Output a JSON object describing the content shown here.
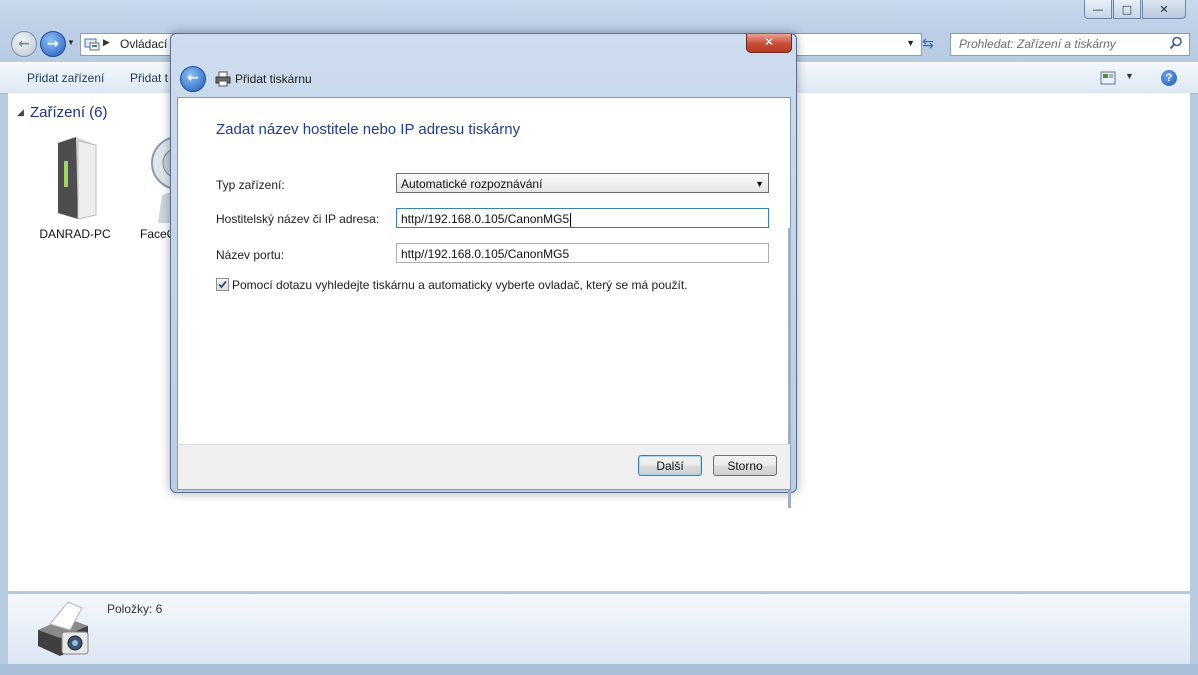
{
  "window": {
    "caption_buttons": {
      "minimize": "—",
      "maximize": "□",
      "close": "✕"
    }
  },
  "address_bar": {
    "path_text": "Ovládací",
    "search_placeholder": "Prohledat: Zařízení a tiskárny"
  },
  "toolbar": {
    "items": [
      "Přidat zařízení",
      "Přidat t"
    ]
  },
  "devices": {
    "group_header": "Zařízení (6)",
    "items": [
      "DANRAD-PC",
      "FaceC"
    ]
  },
  "details": {
    "item_count": "Položky: 6"
  },
  "dialog": {
    "title": "Přidat tiskárnu",
    "heading": "Zadat název hostitele nebo IP adresu tiskárny",
    "device_type_label": "Typ zařízení:",
    "device_type_value": "Automatické rozpoznávání",
    "hostname_label": "Hostitelský název či IP adresa:",
    "hostname_value": "http//192.168.0.105/CanonMG5",
    "port_label": "Název portu:",
    "port_value": "http//192.168.0.105/CanonMG5",
    "checkbox_label": "Pomocí dotazu vyhledejte tiskárnu a automaticky vyberte ovladač, který se má použít.",
    "checkbox_checked": true,
    "next_button": "Další",
    "cancel_button": "Storno"
  }
}
